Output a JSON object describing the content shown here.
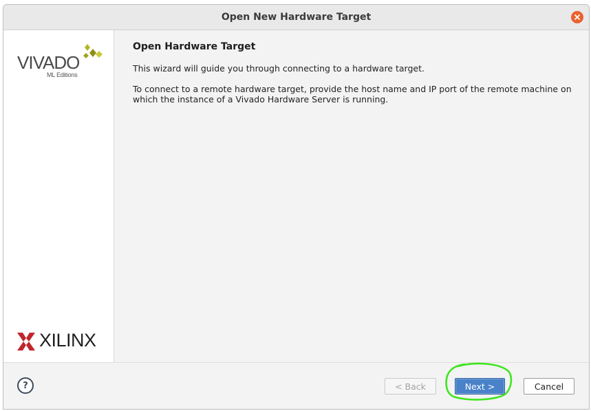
{
  "window": {
    "title": "Open New Hardware Target"
  },
  "sidebar": {
    "product_name": "VIVADO",
    "product_edition": "ML Editions",
    "vendor_name": "XILINX"
  },
  "page": {
    "heading": "Open Hardware Target",
    "intro": "This wizard will guide you through connecting to a hardware target.",
    "detail": "To connect to a remote hardware target, provide the host name and IP port of the remote machine on which the instance of a Vivado Hardware Server is running."
  },
  "footer": {
    "help_label": "?",
    "back_label": "< Back",
    "next_label": "Next >",
    "cancel_label": "Cancel"
  },
  "colors": {
    "close_button": "#e9622f",
    "next_button": "#4a82c9",
    "highlight_annotation": "#3ee51f",
    "xilinx_mark": "#c0272d",
    "vivado_mark": "#b5b52a"
  }
}
